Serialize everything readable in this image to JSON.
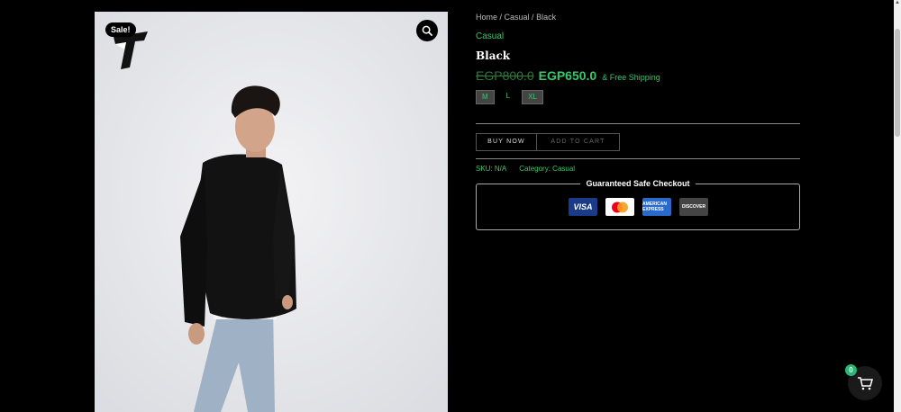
{
  "gallery": {
    "sale_badge": "Sale!"
  },
  "breadcrumb": {
    "home": "Home",
    "separator": " / ",
    "category": "Casual",
    "current": "Black"
  },
  "product": {
    "category_link": "Casual",
    "title": "Black",
    "price_old": "EGP800.0",
    "price_new": "EGP650.0",
    "shipping_note": "& Free Shipping",
    "sizes": [
      {
        "label": "M",
        "boxed": true
      },
      {
        "label": "L",
        "boxed": false
      },
      {
        "label": "XL",
        "boxed": true
      }
    ]
  },
  "actions": {
    "buy_now_label": "BUY NOW",
    "add_to_cart_label": "ADD TO CART"
  },
  "meta": {
    "sku_label": "SKU:",
    "sku_value": "N/A",
    "category_label": "Category:",
    "category_value": "Casual"
  },
  "checkout": {
    "legend": "Guaranteed Safe Checkout",
    "cards": [
      {
        "name": "visa",
        "label": "VISA"
      },
      {
        "name": "mastercard",
        "label": ""
      },
      {
        "name": "amex",
        "label": "AMERICAN EXPRESS"
      },
      {
        "name": "discover",
        "label": "DISCOVER"
      }
    ]
  },
  "cart": {
    "count": "0"
  },
  "colors": {
    "accent_green": "#37c86a",
    "badge_green": "#2bb673",
    "background": "#000000"
  }
}
